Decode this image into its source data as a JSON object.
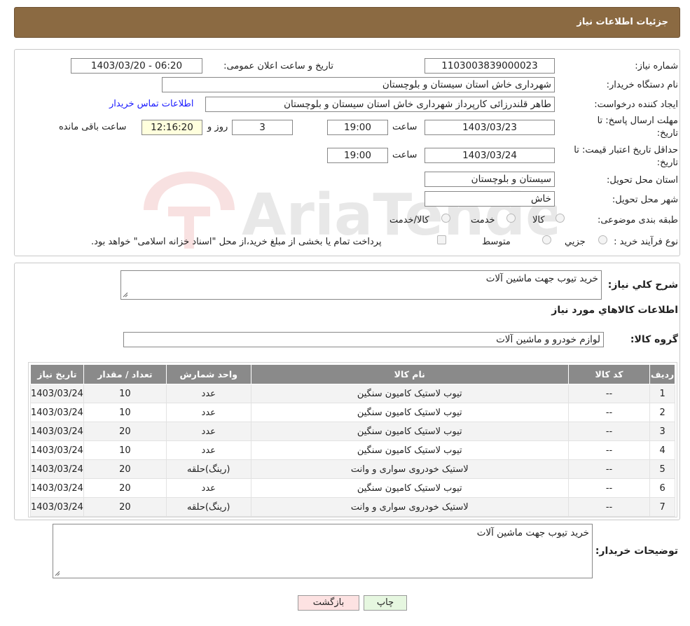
{
  "header": {
    "title": "جزئیات اطلاعات نیاز"
  },
  "form": {
    "need_number_label": "شماره نیاز:",
    "need_number": "1103003839000023",
    "announce_label": "تاریخ و ساعت اعلان عمومی:",
    "announce_value": "1403/03/20 - 06:20",
    "buyer_org_label": "نام دستگاه خریدار:",
    "buyer_org": "شهرداری خاش استان سیستان و بلوچستان",
    "requester_label": "ایجاد کننده درخواست:",
    "requester": "طاهر قلندرزائی کارپرداز شهرداری خاش استان سیستان و بلوچستان",
    "contact_link": "اطلاعات تماس خریدار",
    "deadline_label_1": "مهلت ارسال پاسخ: تا",
    "deadline_label_2": "تاریخ:",
    "deadline_date": "1403/03/23",
    "time_label": "ساعت",
    "deadline_time": "19:00",
    "days_value": "3",
    "days_label": "روز و",
    "remaining_time": "12:16:20",
    "remaining_label": "ساعت باقی مانده",
    "validity_label_1": "حداقل تاریخ اعتبار قیمت: تا",
    "validity_label_2": "تاریخ:",
    "validity_date": "1403/03/24",
    "validity_time": "19:00",
    "province_label": "استان محل تحویل:",
    "province": "سیستان و بلوچستان",
    "city_label": "شهر محل تحویل:",
    "city": "خاش",
    "category_label": "طبقه بندی موضوعی:",
    "category_options": [
      "کالا",
      "خدمت",
      "کالا/خدمت"
    ],
    "process_label": "نوع فرآیند خرید :",
    "process_options": [
      "جزیي",
      "متوسط"
    ],
    "payment_note": "پرداخت تمام یا بخشی از مبلغ خرید،از محل \"اسناد خزانه اسلامی\" خواهد بود."
  },
  "summary": {
    "label": "شرح کلي نياز:",
    "value": "خرید تیوب جهت ماشین آلات",
    "goods_info_title": "اطلاعات کالاهاي مورد نياز",
    "group_label": "گروه کالا:",
    "group_value": "لوازم خودرو و ماشین آلات"
  },
  "table": {
    "headers": [
      "رديف",
      "کد کالا",
      "نام کالا",
      "واحد شمارش",
      "تعداد / مقدار",
      "تاریخ نیاز"
    ],
    "rows": [
      [
        "1",
        "--",
        "تیوب لاستیک کامیون سنگین",
        "عدد",
        "10",
        "1403/03/24"
      ],
      [
        "2",
        "--",
        "تیوب لاستیک کامیون سنگین",
        "عدد",
        "10",
        "1403/03/24"
      ],
      [
        "3",
        "--",
        "تیوب لاستیک کامیون سنگین",
        "عدد",
        "20",
        "1403/03/24"
      ],
      [
        "4",
        "--",
        "تیوب لاستیک کامیون سنگین",
        "عدد",
        "10",
        "1403/03/24"
      ],
      [
        "5",
        "--",
        "لاستیک خودروی سواری و وانت",
        "(رینگ)حلقه",
        "20",
        "1403/03/24"
      ],
      [
        "6",
        "--",
        "تیوب لاستیک کامیون سنگین",
        "عدد",
        "20",
        "1403/03/24"
      ],
      [
        "7",
        "--",
        "لاستیک خودروی سواری و وانت",
        "(رینگ)حلقه",
        "20",
        "1403/03/24"
      ]
    ]
  },
  "buyer_notes": {
    "label": "توضیحات خریدار:",
    "value": "خرید تیوب جهت ماشین آلات"
  },
  "buttons": {
    "print": "چاپ",
    "back": "بازگشت"
  },
  "watermark": {
    "text": "AriaTender.neT"
  },
  "colors": {
    "header": "#8b6a42",
    "table_header": "#8a8a8a",
    "link": "#1a1aff",
    "print_btn": "#e6f7e0",
    "back_btn": "#fde2e2",
    "remaining_bg": "#ffffdd"
  }
}
